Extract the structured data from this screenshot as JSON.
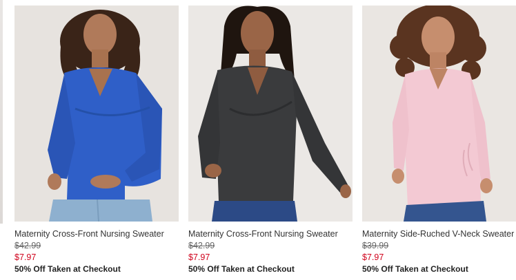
{
  "colors": {
    "sale_price": "#d0021b",
    "original_price": "#666666",
    "product_name": "#333333",
    "promo": "#222222"
  },
  "products": [
    {
      "name": "Maternity Cross-Front Nursing Sweater",
      "original_price": "$42.99",
      "sale_price": "$7.97",
      "promo": "50% Off Taken at Checkout",
      "image_alt": "model wearing blue cross-front sweater",
      "sweater_color": "#2f5fc8"
    },
    {
      "name": "Maternity Cross-Front Nursing Sweater",
      "original_price": "$42.99",
      "sale_price": "$7.97",
      "promo": "50% Off Taken at Checkout",
      "image_alt": "model wearing charcoal cross-front sweater",
      "sweater_color": "#3a3b3d"
    },
    {
      "name": "Maternity Side-Ruched V-Neck Sweater",
      "original_price": "$39.99",
      "sale_price": "$7.97",
      "promo": "50% Off Taken at Checkout",
      "image_alt": "model wearing pink side-ruched v-neck sweater",
      "sweater_color": "#f3c9d3"
    }
  ]
}
